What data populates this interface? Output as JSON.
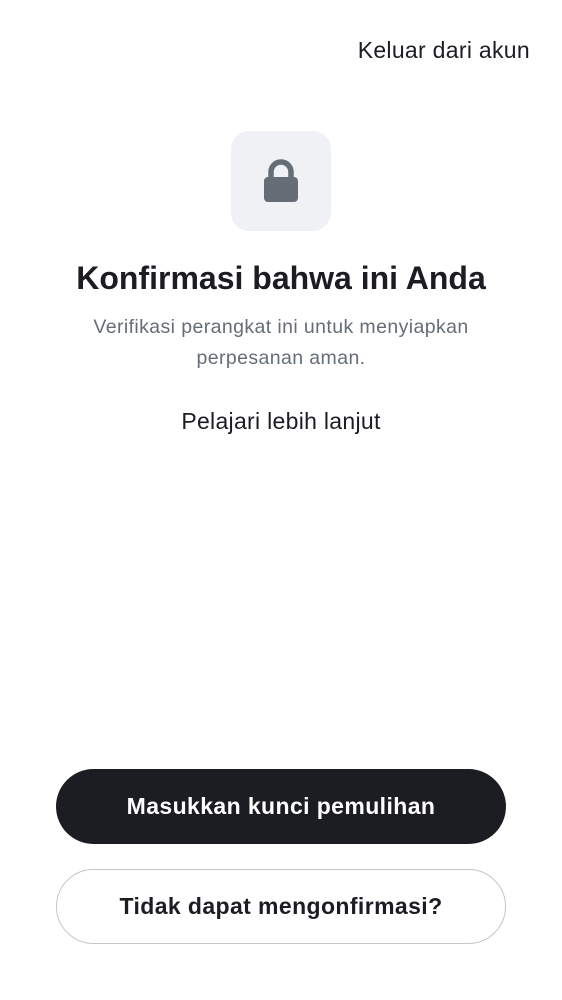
{
  "header": {
    "sign_out_label": "Keluar dari akun"
  },
  "hero": {
    "icon": "lock-icon",
    "title": "Konfirmasi bahwa ini Anda",
    "subtitle": "Verifikasi perangkat ini untuk menyiapkan perpesanan aman.",
    "learn_more_label": "Pelajari lebih lanjut"
  },
  "actions": {
    "primary_label": "Masukkan kunci pemulihan",
    "secondary_label": "Tidak dapat mengonfirmasi?"
  },
  "colors": {
    "text_primary": "#1b1d22",
    "text_secondary": "#656d77",
    "icon_tile_bg": "#eff1f5",
    "icon_color": "#656d77",
    "primary_button_bg": "#1b1d22",
    "secondary_button_border": "#c2c6cd"
  }
}
